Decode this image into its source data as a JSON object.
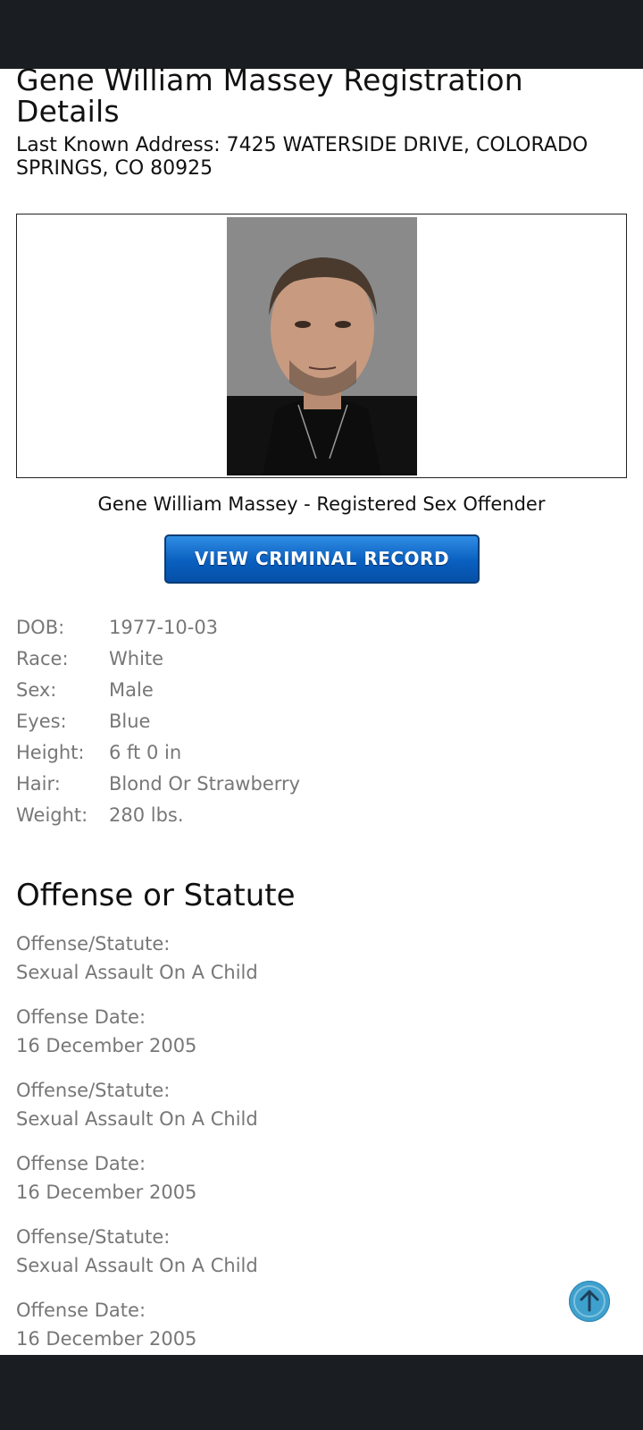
{
  "header": {
    "title": "Gene William Massey Registration Details",
    "address": "Last Known Address: 7425 WATERSIDE DRIVE, COLORADO SPRINGS, CO 80925"
  },
  "photo": {
    "caption": "Gene William Massey - Registered Sex Offender"
  },
  "button": {
    "label": "VIEW CRIMINAL RECORD"
  },
  "details": [
    {
      "label": "DOB:",
      "value": "1977-10-03"
    },
    {
      "label": "Race:",
      "value": "White"
    },
    {
      "label": "Sex:",
      "value": "Male"
    },
    {
      "label": "Eyes:",
      "value": "Blue"
    },
    {
      "label": "Height:",
      "value": "6 ft 0 in"
    },
    {
      "label": "Hair:",
      "value": "Blond Or Strawberry"
    },
    {
      "label": "Weight:",
      "value": "280 lbs."
    }
  ],
  "offense_section": {
    "title": "Offense or Statute",
    "items": [
      {
        "label": "Offense/Statute:",
        "value": "Sexual Assault On A Child"
      },
      {
        "label": "Offense Date:",
        "value": "16 December 2005"
      },
      {
        "label": "Offense/Statute:",
        "value": "Sexual Assault On A Child"
      },
      {
        "label": "Offense Date:",
        "value": "16 December 2005"
      },
      {
        "label": "Offense/Statute:",
        "value": "Sexual Assault On A Child"
      },
      {
        "label": "Offense Date:",
        "value": "16 December 2005"
      }
    ]
  },
  "icons": {
    "scroll_top": "arrow-up-icon"
  },
  "colors": {
    "topbar": "#1a1d21",
    "button": "#0a5fbf",
    "scroll_top": "#3ea0cd"
  }
}
